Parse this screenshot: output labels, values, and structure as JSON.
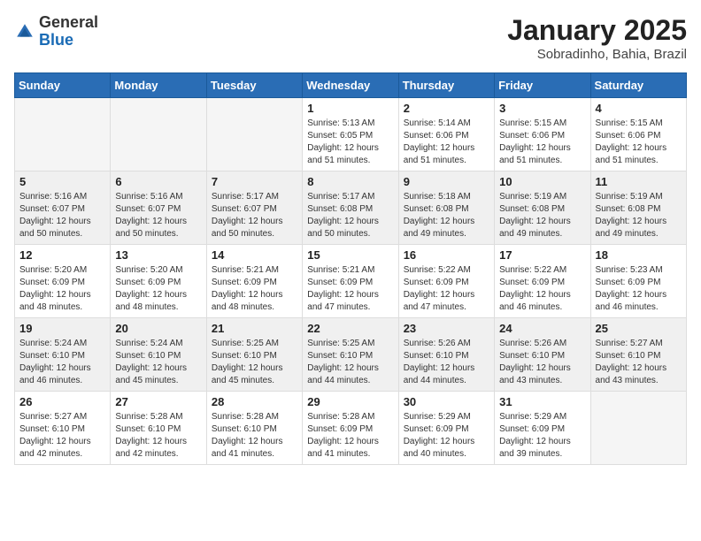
{
  "header": {
    "logo_general": "General",
    "logo_blue": "Blue",
    "month_title": "January 2025",
    "location": "Sobradinho, Bahia, Brazil"
  },
  "weekdays": [
    "Sunday",
    "Monday",
    "Tuesday",
    "Wednesday",
    "Thursday",
    "Friday",
    "Saturday"
  ],
  "weeks": [
    {
      "shaded": false,
      "days": [
        {
          "num": "",
          "info": ""
        },
        {
          "num": "",
          "info": ""
        },
        {
          "num": "",
          "info": ""
        },
        {
          "num": "1",
          "info": "Sunrise: 5:13 AM\nSunset: 6:05 PM\nDaylight: 12 hours\nand 51 minutes."
        },
        {
          "num": "2",
          "info": "Sunrise: 5:14 AM\nSunset: 6:06 PM\nDaylight: 12 hours\nand 51 minutes."
        },
        {
          "num": "3",
          "info": "Sunrise: 5:15 AM\nSunset: 6:06 PM\nDaylight: 12 hours\nand 51 minutes."
        },
        {
          "num": "4",
          "info": "Sunrise: 5:15 AM\nSunset: 6:06 PM\nDaylight: 12 hours\nand 51 minutes."
        }
      ]
    },
    {
      "shaded": true,
      "days": [
        {
          "num": "5",
          "info": "Sunrise: 5:16 AM\nSunset: 6:07 PM\nDaylight: 12 hours\nand 50 minutes."
        },
        {
          "num": "6",
          "info": "Sunrise: 5:16 AM\nSunset: 6:07 PM\nDaylight: 12 hours\nand 50 minutes."
        },
        {
          "num": "7",
          "info": "Sunrise: 5:17 AM\nSunset: 6:07 PM\nDaylight: 12 hours\nand 50 minutes."
        },
        {
          "num": "8",
          "info": "Sunrise: 5:17 AM\nSunset: 6:08 PM\nDaylight: 12 hours\nand 50 minutes."
        },
        {
          "num": "9",
          "info": "Sunrise: 5:18 AM\nSunset: 6:08 PM\nDaylight: 12 hours\nand 49 minutes."
        },
        {
          "num": "10",
          "info": "Sunrise: 5:19 AM\nSunset: 6:08 PM\nDaylight: 12 hours\nand 49 minutes."
        },
        {
          "num": "11",
          "info": "Sunrise: 5:19 AM\nSunset: 6:08 PM\nDaylight: 12 hours\nand 49 minutes."
        }
      ]
    },
    {
      "shaded": false,
      "days": [
        {
          "num": "12",
          "info": "Sunrise: 5:20 AM\nSunset: 6:09 PM\nDaylight: 12 hours\nand 48 minutes."
        },
        {
          "num": "13",
          "info": "Sunrise: 5:20 AM\nSunset: 6:09 PM\nDaylight: 12 hours\nand 48 minutes."
        },
        {
          "num": "14",
          "info": "Sunrise: 5:21 AM\nSunset: 6:09 PM\nDaylight: 12 hours\nand 48 minutes."
        },
        {
          "num": "15",
          "info": "Sunrise: 5:21 AM\nSunset: 6:09 PM\nDaylight: 12 hours\nand 47 minutes."
        },
        {
          "num": "16",
          "info": "Sunrise: 5:22 AM\nSunset: 6:09 PM\nDaylight: 12 hours\nand 47 minutes."
        },
        {
          "num": "17",
          "info": "Sunrise: 5:22 AM\nSunset: 6:09 PM\nDaylight: 12 hours\nand 46 minutes."
        },
        {
          "num": "18",
          "info": "Sunrise: 5:23 AM\nSunset: 6:09 PM\nDaylight: 12 hours\nand 46 minutes."
        }
      ]
    },
    {
      "shaded": true,
      "days": [
        {
          "num": "19",
          "info": "Sunrise: 5:24 AM\nSunset: 6:10 PM\nDaylight: 12 hours\nand 46 minutes."
        },
        {
          "num": "20",
          "info": "Sunrise: 5:24 AM\nSunset: 6:10 PM\nDaylight: 12 hours\nand 45 minutes."
        },
        {
          "num": "21",
          "info": "Sunrise: 5:25 AM\nSunset: 6:10 PM\nDaylight: 12 hours\nand 45 minutes."
        },
        {
          "num": "22",
          "info": "Sunrise: 5:25 AM\nSunset: 6:10 PM\nDaylight: 12 hours\nand 44 minutes."
        },
        {
          "num": "23",
          "info": "Sunrise: 5:26 AM\nSunset: 6:10 PM\nDaylight: 12 hours\nand 44 minutes."
        },
        {
          "num": "24",
          "info": "Sunrise: 5:26 AM\nSunset: 6:10 PM\nDaylight: 12 hours\nand 43 minutes."
        },
        {
          "num": "25",
          "info": "Sunrise: 5:27 AM\nSunset: 6:10 PM\nDaylight: 12 hours\nand 43 minutes."
        }
      ]
    },
    {
      "shaded": false,
      "days": [
        {
          "num": "26",
          "info": "Sunrise: 5:27 AM\nSunset: 6:10 PM\nDaylight: 12 hours\nand 42 minutes."
        },
        {
          "num": "27",
          "info": "Sunrise: 5:28 AM\nSunset: 6:10 PM\nDaylight: 12 hours\nand 42 minutes."
        },
        {
          "num": "28",
          "info": "Sunrise: 5:28 AM\nSunset: 6:10 PM\nDaylight: 12 hours\nand 41 minutes."
        },
        {
          "num": "29",
          "info": "Sunrise: 5:28 AM\nSunset: 6:09 PM\nDaylight: 12 hours\nand 41 minutes."
        },
        {
          "num": "30",
          "info": "Sunrise: 5:29 AM\nSunset: 6:09 PM\nDaylight: 12 hours\nand 40 minutes."
        },
        {
          "num": "31",
          "info": "Sunrise: 5:29 AM\nSunset: 6:09 PM\nDaylight: 12 hours\nand 39 minutes."
        },
        {
          "num": "",
          "info": ""
        }
      ]
    }
  ]
}
